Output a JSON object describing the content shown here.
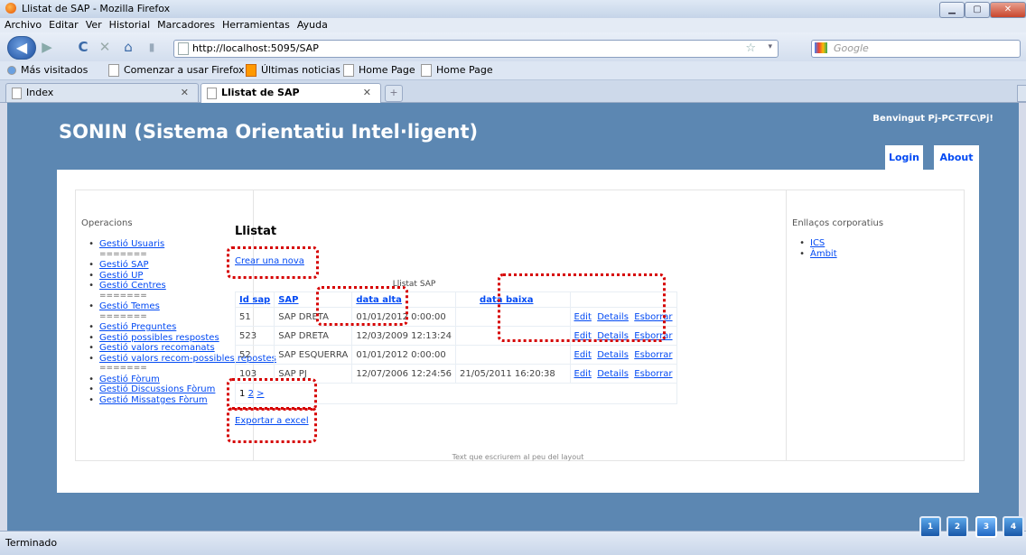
{
  "window": {
    "title": "Llistat de SAP - Mozilla Firefox"
  },
  "menubar": [
    "Archivo",
    "Editar",
    "Ver",
    "Historial",
    "Marcadores",
    "Herramientas",
    "Ayuda"
  ],
  "navbar": {
    "url": "http://localhost:5095/SAP",
    "search_placeholder": "Google"
  },
  "bookmarks": [
    "Más visitados",
    "Comenzar a usar Firefox",
    "Últimas noticias",
    "Home Page",
    "Home Page"
  ],
  "tabs": [
    {
      "label": "Index"
    },
    {
      "label": "Llistat de SAP"
    }
  ],
  "site": {
    "title": "SONIN (Sistema Orientatiu Intel·ligent)",
    "welcome": "Benvingut Pj-PC-TFC\\Pj!",
    "login": "Login",
    "about": "About",
    "footer": "Text que escriurem al peu del layout"
  },
  "left": {
    "heading": "Operacions",
    "items": [
      "Gestió Usuaris",
      "=======",
      "Gestió SAP",
      "Gestió UP",
      "Gestió Centres",
      "=======",
      "Gestió Temes",
      "=======",
      "Gestió Preguntes",
      "Gestió possibles respostes",
      "Gestió valors recomanats",
      "Gestió valors recom-possibles repostes",
      "=======",
      "Gestió Fòrum",
      "Gestió Discussions Fòrum",
      "Gestió Missatges Fòrum"
    ]
  },
  "right": {
    "heading": "Enllaços corporatius",
    "items": [
      "ICS",
      "Àmbit"
    ]
  },
  "main": {
    "heading": "Llistat",
    "create": "Crear una nova",
    "caption": "Llistat SAP",
    "columns": [
      "Id sap",
      "SAP",
      "data alta",
      "data baixa"
    ],
    "rows": [
      {
        "id": "51",
        "sap": "SAP DRETA",
        "alta": "01/01/2012 0:00:00",
        "baixa": ""
      },
      {
        "id": "523",
        "sap": "SAP DRETA",
        "alta": "12/03/2009 12:13:24",
        "baixa": ""
      },
      {
        "id": "52",
        "sap": "SAP ESQUERRA",
        "alta": "01/01/2012 0:00:00",
        "baixa": ""
      },
      {
        "id": "103",
        "sap": "SAP PJ",
        "alta": "12/07/2006 12:24:56",
        "baixa": "21/05/2011 16:20:38"
      }
    ],
    "actions": [
      "Edit",
      "Details",
      "Esborrar"
    ],
    "pager_current": "1",
    "pager_next": "2",
    "pager_more": ">",
    "export": "Exportar a excel"
  },
  "status": {
    "text": "Terminado"
  },
  "desktops": [
    "1",
    "2",
    "3",
    "4"
  ]
}
